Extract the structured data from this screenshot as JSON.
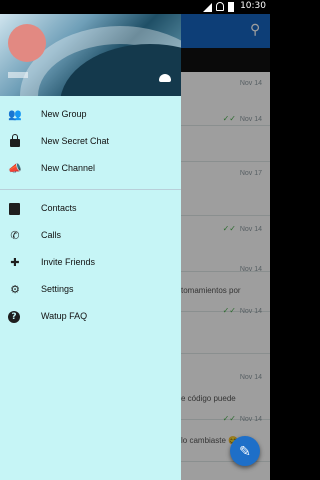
{
  "status_bar": {
    "time": "10:30"
  },
  "background_chat": {
    "rows": [
      {
        "time": "Nov 14",
        "check": "",
        "snippet": ""
      },
      {
        "time": "Nov 14",
        "check": "✓✓",
        "snippet": ""
      },
      {
        "time": "Nov 17",
        "check": "",
        "snippet": ""
      },
      {
        "time": "Nov 14",
        "check": "✓✓",
        "snippet": ""
      },
      {
        "time": "Nov 14",
        "check": "",
        "snippet": "tomamientos por"
      },
      {
        "time": "Nov 14",
        "check": "✓✓",
        "snippet": ""
      },
      {
        "time": "Nov 14",
        "check": "",
        "snippet": "e código puede"
      },
      {
        "time": "Nov 14",
        "check": "✓✓",
        "snippet": "lo cambiaste 😋"
      }
    ]
  },
  "drawer": {
    "menu_primary": [
      {
        "label": "New Group",
        "icon": "group-icon"
      },
      {
        "label": "New Secret Chat",
        "icon": "lock-icon"
      },
      {
        "label": "New Channel",
        "icon": "megaphone-icon"
      }
    ],
    "menu_secondary": [
      {
        "label": "Contacts",
        "icon": "contacts-icon"
      },
      {
        "label": "Calls",
        "icon": "phone-icon"
      },
      {
        "label": "Invite Friends",
        "icon": "add-person-icon"
      },
      {
        "label": "Settings",
        "icon": "gear-icon"
      },
      {
        "label": "Watup FAQ",
        "icon": "help-icon"
      }
    ]
  },
  "colors": {
    "drawer_bg": "#c6f5f6",
    "app_bar": "#1565c0",
    "fab": "#1e6fc8",
    "avatar": "#e28982"
  }
}
